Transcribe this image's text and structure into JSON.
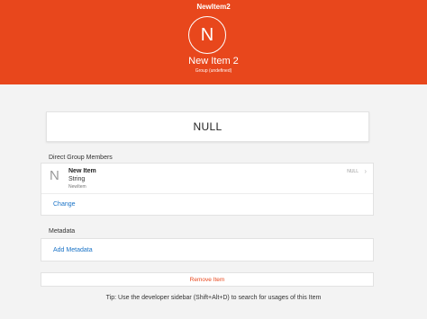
{
  "window": {
    "title": "NewItem2"
  },
  "header": {
    "avatar_initial": "N",
    "item_title": "New Item 2",
    "group_text": "Group (undefined)"
  },
  "value_card": {
    "value": "NULL"
  },
  "members": {
    "section_label": "Direct Group Members",
    "items": [
      {
        "initial": "N",
        "name": "New Item",
        "type": "String",
        "id": "NewItem",
        "value": "NULL"
      }
    ],
    "change_label": "Change"
  },
  "metadata": {
    "section_label": "Metadata",
    "add_label": "Add Metadata"
  },
  "remove": {
    "label": "Remove Item"
  },
  "tip": {
    "text": "Tip: Use the developer sidebar (Shift+Alt+D) to search for usages of this Item"
  },
  "colors": {
    "accent": "#e8471c",
    "link": "#1a73c7"
  },
  "icons": {
    "row_chevron": "chevron-right-icon"
  }
}
